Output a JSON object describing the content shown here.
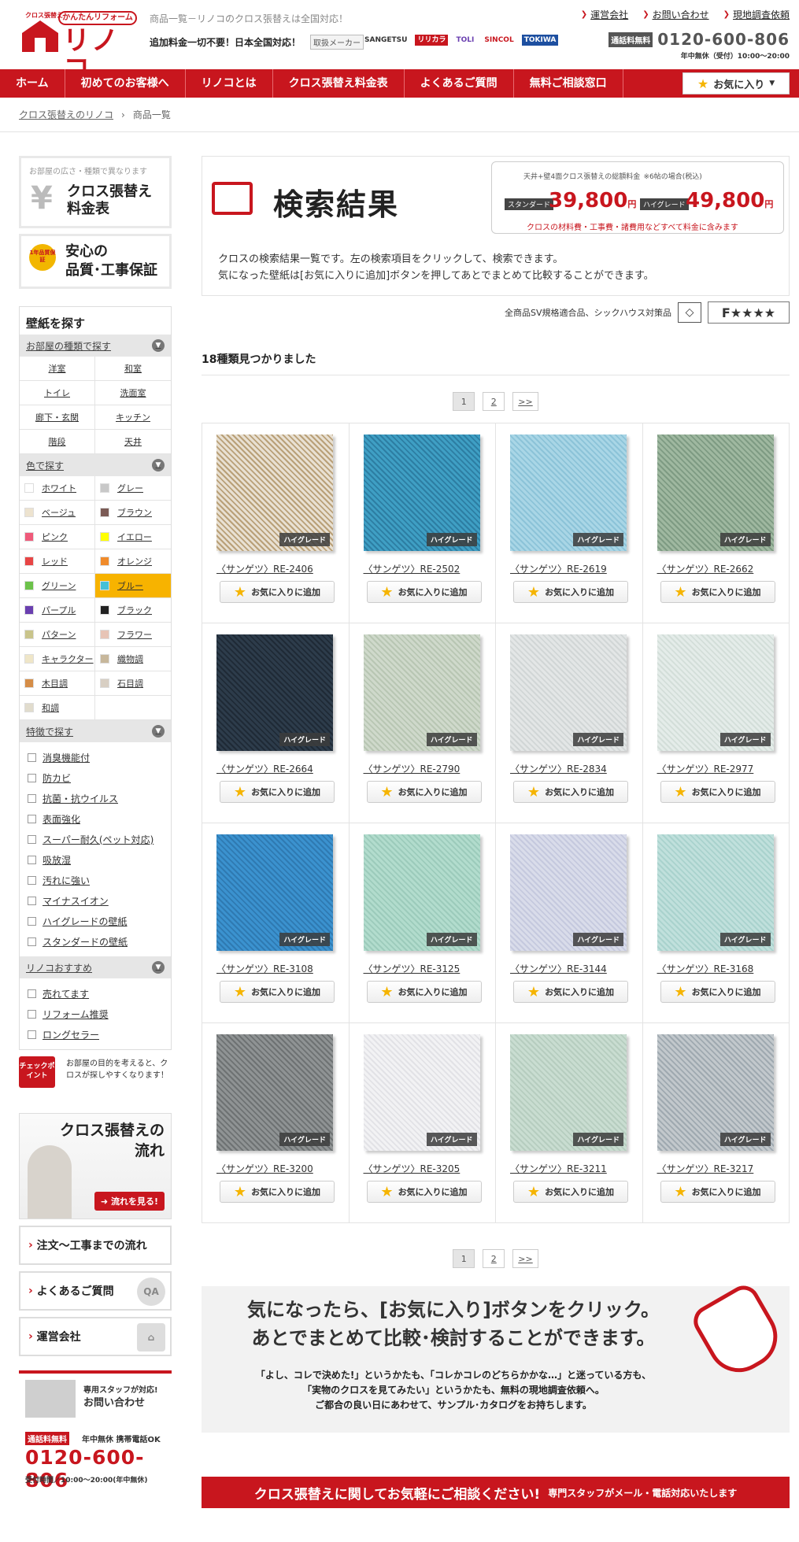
{
  "header": {
    "logo_small": "クロス張替え",
    "logo_badge": "かんたんリフォーム",
    "logo_name": "リノコ",
    "tagline": "商品一覧－リノコのクロス張替えは全国対応！",
    "subline": "追加料金一切不要！日本全国対応！",
    "maker_label": "取扱メーカー",
    "makers": [
      "SANGETSU",
      "リリカラ",
      "TOLI",
      "SINCOL",
      "TOKIWA"
    ],
    "top_links": [
      "運営会社",
      "お問い合わせ",
      "現地調査依頼"
    ],
    "free_badge": "通話料無料",
    "phone": "0120-600-806",
    "hours": "年中無休（受付）10:00～20:00"
  },
  "nav": {
    "items": [
      "ホーム",
      "初めてのお客様へ",
      "リノコとは",
      "クロス張替え料金表",
      "よくあるご質問",
      "無料ご相談窓口"
    ],
    "favorite": "お気に入り"
  },
  "breadcrumb": {
    "home": "クロス張替えのリノコ",
    "current": "商品一覧"
  },
  "sidebar": {
    "price_banner": {
      "small": "お部屋の広さ・種類で異なります",
      "line1": "クロス張替え",
      "line2": "料金表"
    },
    "guarantee_banner": {
      "medal": "1年品質保証",
      "line1": "安心の",
      "line2": "品質･工事保証"
    },
    "wall_title": "壁紙を探す",
    "room_head": "お部屋の種類で探す",
    "rooms": [
      "洋室",
      "和室",
      "トイレ",
      "洗面室",
      "廊下・玄関",
      "キッチン",
      "階段",
      "天井"
    ],
    "color_head": "色で探す",
    "colors": [
      {
        "label": "ホワイト",
        "color": "#ffffff"
      },
      {
        "label": "グレー",
        "color": "#c8c8c8"
      },
      {
        "label": "ベージュ",
        "color": "#ede3cf"
      },
      {
        "label": "ブラウン",
        "color": "#7b5a55"
      },
      {
        "label": "ピンク",
        "color": "#ef5a7a"
      },
      {
        "label": "イエロー",
        "color": "#ffff00"
      },
      {
        "label": "レッド",
        "color": "#e84545"
      },
      {
        "label": "オレンジ",
        "color": "#f08b2a"
      },
      {
        "label": "グリーン",
        "color": "#6cc24a"
      },
      {
        "label": "ブルー",
        "color": "#45c0d6"
      },
      {
        "label": "パープル",
        "color": "#6a3fb0"
      },
      {
        "label": "ブラック",
        "color": "#222222"
      },
      {
        "label": "パターン",
        "color": "#c9c48b"
      },
      {
        "label": "フラワー",
        "color": "#e7c4b6"
      },
      {
        "label": "キャラクター",
        "color": "#efe6c8"
      },
      {
        "label": "織物調",
        "color": "#c7b79b"
      },
      {
        "label": "木目調",
        "color": "#d58d47"
      },
      {
        "label": "石目調",
        "color": "#d8cfc3"
      },
      {
        "label": "和調",
        "color": "#e1dccd"
      }
    ],
    "active_color": "ブルー",
    "feature_head": "特徴で探す",
    "features": [
      "消臭機能付",
      "防カビ",
      "抗菌・抗ウイルス",
      "表面強化",
      "スーパー耐久(ペット対応)",
      "吸放湿",
      "汚れに強い",
      "マイナスイオン",
      "ハイグレードの壁紙",
      "スタンダードの壁紙"
    ],
    "recommend_head": "リノコおすすめ",
    "recommends": [
      "売れてます",
      "リフォーム推奨",
      "ロングセラー"
    ],
    "checkpoint_badge": "チェックポイント",
    "checkpoint_text": "お部屋の目的を考えると、クロスが探しやすくなります！",
    "flow_title1": "クロス張替えの",
    "flow_title2": "流れ",
    "flow_btn": "流れを見る!",
    "link_boxes": [
      "注文～工事までの流れ",
      "よくあるご質問",
      "運営会社"
    ],
    "contact_line1": "専用スタッフが対応!",
    "contact_line2": "お問い合わせ",
    "contact_free": "通話料無料",
    "contact_ok": "年中無休 携帯電話OK",
    "contact_phone": "0120-600-806",
    "contact_hours": "受付時間／10:00～20:00(年中無休)"
  },
  "main": {
    "title": "検索結果",
    "price_box": {
      "title": "天井+壁4面クロス張替えの総額料金",
      "title_note": "※6帖の場合(税込)",
      "std_tag": "スタンダード",
      "std_price": "39,800",
      "hg_tag": "ハイグレード",
      "hg_price": "49,800",
      "yen": "円",
      "note": "クロスの材料費・工事費・諸費用などすべて料金に含みます"
    },
    "desc1": "クロスの検索結果一覧です。左の検索項目をクリックして、検索できます。",
    "desc2": "気になった壁紙は[お気に入りに追加]ボタンを押してあとでまとめて比較することができます。",
    "std_text": "全商品SV規格適合品、シックハウス対策品",
    "fstar": "F★★★★",
    "count": "18種類見つかりました",
    "pager": [
      "1",
      "2",
      ">>"
    ],
    "grade_label": "ハイグレード",
    "add_label": "お気に入りに追加",
    "products": [
      {
        "name": "〈サンゲツ〉RE-2406",
        "c1": "#e8e0d2",
        "c2": "#b9a078"
      },
      {
        "name": "〈サンゲツ〉RE-2502",
        "c1": "#3f9fc4",
        "c2": "#2d7ea3"
      },
      {
        "name": "〈サンゲツ〉RE-2619",
        "c1": "#a9d6e6",
        "c2": "#8cc3d8"
      },
      {
        "name": "〈サンゲツ〉RE-2662",
        "c1": "#9fb8a0",
        "c2": "#7e9b83"
      },
      {
        "name": "〈サンゲツ〉RE-2664",
        "c1": "#2d3c4b",
        "c2": "#1f2a36"
      },
      {
        "name": "〈サンゲツ〉RE-2790",
        "c1": "#cfd9cb",
        "c2": "#b8c6b3"
      },
      {
        "name": "〈サンゲツ〉RE-2834",
        "c1": "#e3e6e6",
        "c2": "#d1d6d6"
      },
      {
        "name": "〈サンゲツ〉RE-2977",
        "c1": "#e4ece9",
        "c2": "#d3ded9"
      },
      {
        "name": "〈サンゲツ〉RE-3108",
        "c1": "#3b92cf",
        "c2": "#2f7ab2"
      },
      {
        "name": "〈サンゲツ〉RE-3125",
        "c1": "#b2dccd",
        "c2": "#9ccbbb"
      },
      {
        "name": "〈サンゲツ〉RE-3144",
        "c1": "#d9dcea",
        "c2": "#c5c9de"
      },
      {
        "name": "〈サンゲツ〉RE-3168",
        "c1": "#c0e0dc",
        "c2": "#a9d2cd"
      },
      {
        "name": "〈サンゲツ〉RE-3200",
        "c1": "#8f9394",
        "c2": "#6e7273"
      },
      {
        "name": "〈サンゲツ〉RE-3205",
        "c1": "#f2f2f4",
        "c2": "#e2e2e6"
      },
      {
        "name": "〈サンゲツ〉RE-3211",
        "c1": "#c9ddd1",
        "c2": "#b6cdbf"
      },
      {
        "name": "〈サンゲツ〉RE-3217",
        "c1": "#c2c8cc",
        "c2": "#9fa9b0"
      }
    ],
    "promo_h1": "気になったら、[お気に入り]ボタンをクリック。",
    "promo_h2": "あとでまとめて比較･検討することができます。",
    "promo_p1": "「よし、コレで決めた!」というかたも、「コレかコレのどちらかかな…」と迷っている方も、",
    "promo_p2": "「実物のクロスを見てみたい」というかたも、無料の現地調査依頼へ。",
    "promo_p3": "ご都合の良い日にあわせて、サンプル･カタログをお持ちします。",
    "bottom_main": "クロス張替えに関してお気軽にご相談ください!",
    "bottom_sub": "専門スタッフがメール・電話対応いたします"
  }
}
